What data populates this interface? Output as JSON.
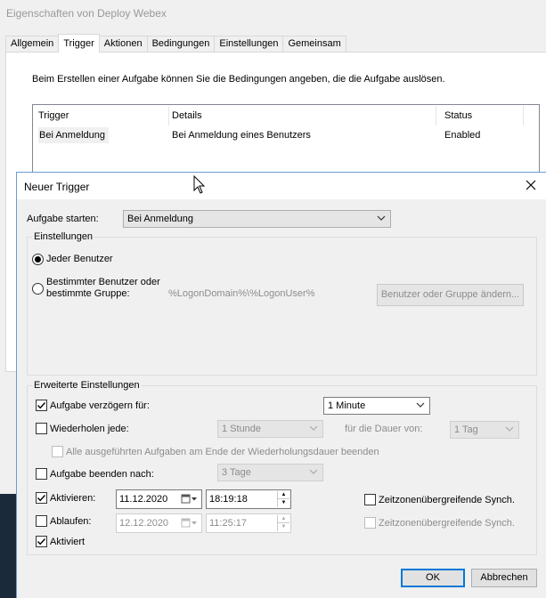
{
  "background_window": {
    "title": "Eigenschaften von Deploy Webex",
    "tabs": [
      "Allgemein",
      "Trigger",
      "Aktionen",
      "Bedingungen",
      "Einstellungen",
      "Gemeinsam"
    ],
    "active_tab": "Trigger",
    "description": "Beim Erstellen einer Aufgabe können Sie die Bedingungen angeben, die die Aufgabe auslösen.",
    "table": {
      "headers": [
        "Trigger",
        "Details",
        "Status"
      ],
      "rows": [
        {
          "trigger": "Bei Anmeldung",
          "details": "Bei Anmeldung eines Benutzers",
          "status": "Enabled"
        }
      ]
    }
  },
  "dialog": {
    "title": "Neuer Trigger",
    "close_icon": "close-icon",
    "start_task": {
      "label": "Aufgabe starten:",
      "value": "Bei Anmeldung"
    },
    "settings_group": {
      "title": "Einstellungen",
      "radio_any_user": {
        "label": "Jeder Benutzer",
        "selected": true
      },
      "radio_specific_user": {
        "label_line1": "Bestimmter Benutzer oder",
        "label_line2": "bestimmte Gruppe:",
        "selected": false
      },
      "user_value": "%LogonDomain%\\%LogonUser%",
      "change_user_button": "Benutzer oder Gruppe ändern..."
    },
    "advanced_group": {
      "title": "Erweiterte Einstellungen",
      "delay": {
        "label": "Aufgabe verzögern für:",
        "checked": true,
        "value": "1 Minute"
      },
      "repeat": {
        "label": "Wiederholen jede:",
        "checked": false,
        "value": "1 Stunde",
        "duration_label": "für die Dauer von:",
        "duration_value": "1 Tag"
      },
      "stop_all": {
        "label": "Alle ausgeführten Aufgaben am Ende der Wiederholungsdauer beenden",
        "checked": false
      },
      "stop_after": {
        "label": "Aufgabe beenden nach:",
        "checked": false,
        "value": "3 Tage"
      },
      "activate": {
        "label": "Aktivieren:",
        "checked": true,
        "date": "11.12.2020",
        "time": "18:19:18",
        "sync_label": "Zeitzonenübergreifende Synch.",
        "sync_checked": false
      },
      "expire": {
        "label": "Ablaufen:",
        "checked": false,
        "date": "12.12.2020",
        "time": "11:25:17",
        "sync_label": "Zeitzonenübergreifende Synch.",
        "sync_checked": false
      },
      "enabled": {
        "label": "Aktiviert",
        "checked": true
      }
    },
    "ok_button": "OK",
    "cancel_button": "Abbrechen"
  },
  "colors": {
    "accent": "#0078d7",
    "dialog_border": "#6a9bd4"
  }
}
